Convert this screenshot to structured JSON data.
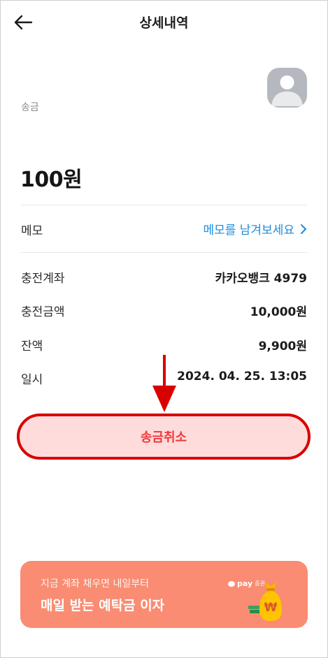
{
  "header": {
    "title": "상세내역",
    "back_icon": "arrow-left-icon"
  },
  "transaction": {
    "type": "송금",
    "amount": "100원"
  },
  "memo": {
    "label": "메모",
    "link": "메모를 남겨보세요"
  },
  "details": [
    {
      "label": "충전계좌",
      "value": "카카오뱅크 4979"
    },
    {
      "label": "충전금액",
      "value": "10,000원"
    },
    {
      "label": "잔액",
      "value": "9,900원"
    },
    {
      "label": "일시",
      "value": "2024. 04. 25. 13:05"
    }
  ],
  "cancel_button": {
    "label": "송금취소"
  },
  "banner": {
    "subtitle": "지금 계좌 채우면 내일부터",
    "title": "매일 받는 예탁금 이자",
    "badge_brand": "pay",
    "badge_suffix": "증권",
    "icon": "money-bag-icon"
  },
  "colors": {
    "accent_link": "#1e8bdc",
    "cancel_text": "#ef3a3a",
    "cancel_bg": "#ffdcdc",
    "annotation_red": "#d90000",
    "banner_bg": "#f98c72",
    "avatar_bg": "#b5b9bf"
  }
}
